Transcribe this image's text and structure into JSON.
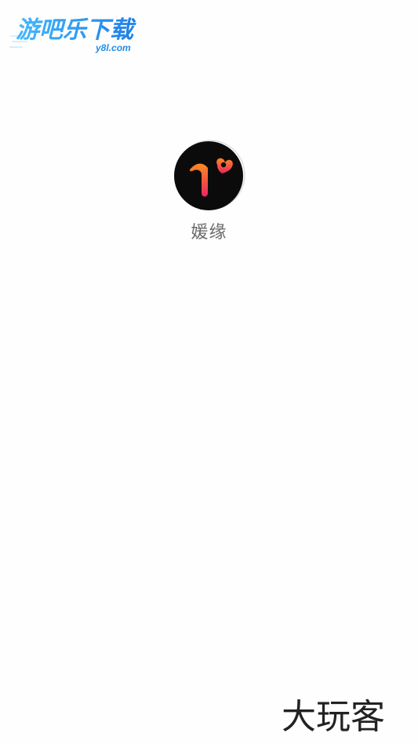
{
  "watermark": {
    "title": "游吧乐下载",
    "domain": "y8l.com",
    "color": "#2aa7f0"
  },
  "app": {
    "name": "媛缘",
    "icon": "yuanyuan-app-icon",
    "logo_colors": {
      "background": "#0b0b0b",
      "gradient_start": "#ff8a1f",
      "gradient_end": "#e8265f"
    }
  },
  "brand": {
    "text": "大玩客",
    "color": "#222222"
  }
}
